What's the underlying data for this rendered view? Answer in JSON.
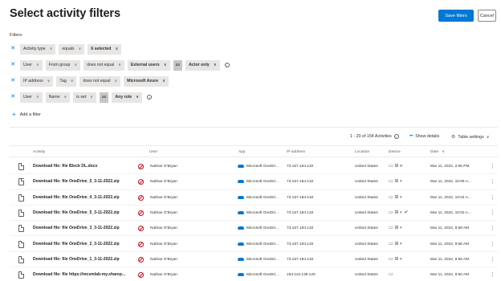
{
  "header": {
    "title": "Select activity filters",
    "save_label": "Save filters",
    "cancel_label": "Cancel"
  },
  "filters_label": "Filters:",
  "filters": [
    {
      "parts": [
        "Activity type",
        "equals",
        "6 selected"
      ],
      "bold": [
        false,
        false,
        true
      ],
      "info": false
    },
    {
      "parts": [
        "User",
        "From group",
        "does not equal",
        "External users",
        "as",
        "Actor only"
      ],
      "bold": [
        false,
        false,
        false,
        true,
        false,
        true
      ],
      "info": true
    },
    {
      "parts": [
        "IP address",
        "Tag",
        "does not equal",
        "Microsoft Azure"
      ],
      "bold": [
        false,
        false,
        false,
        true
      ],
      "info": false
    },
    {
      "parts": [
        "User",
        "Name",
        "is set",
        "as",
        "Any role"
      ],
      "bold": [
        false,
        false,
        false,
        false,
        true
      ],
      "info": true
    }
  ],
  "add_filter_label": "Add a filter",
  "summary": {
    "count_text": "1 - 20 of 154 Activities",
    "show_details": "Show details",
    "table_settings": "Table settings"
  },
  "table": {
    "headers": {
      "activity": "Activity",
      "user": "User",
      "app": "App",
      "ip": "IP address",
      "location": "Location",
      "device": "Device",
      "date": "Date"
    },
    "sort_indicator": "∨",
    "rows": [
      {
        "activity": "Download file: file Block DL.docx",
        "user": "Nathan O'Bryan",
        "app": "Microsoft OneDri...",
        "ip": "73.157.184.132",
        "location": "United States",
        "device": "▭ ⊞ ℯ",
        "date": "Mar 11, 2022, 2:55 PM"
      },
      {
        "activity": "Download file: file OneDrive_5_3-11-2022.zip",
        "user": "Nathan O'Bryan",
        "app": "Microsoft OneDri...",
        "ip": "73.157.184.132",
        "location": "United States",
        "device": "▭ ⊞ ◐",
        "date": "Mar 11, 2022, 10:05 A..."
      },
      {
        "activity": "Download file: file OneDrive_4_3-11-2022.zip",
        "user": "Nathan O'Bryan",
        "app": "Microsoft OneDri...",
        "ip": "73.157.184.132",
        "location": "United States",
        "device": "▭ ⊞ ◐",
        "date": "Mar 11, 2022, 10:04 A..."
      },
      {
        "activity": "Download file: file OneDrive_5_3-11-2022.zip",
        "user": "Nathan O'Bryan",
        "app": "Microsoft OneDri...",
        "ip": "73.157.184.132",
        "location": "United States",
        "device": "▭ ⊞ ◐ ✔",
        "date": "Mar 11, 2022, 10:02 A..."
      },
      {
        "activity": "Download file: file OneDrive_3_3-11-2022.zip",
        "user": "Nathan O'Bryan",
        "app": "Microsoft OneDri...",
        "ip": "73.157.184.132",
        "location": "United States",
        "device": "▭ ⊞ ◐",
        "date": "Mar 11, 2022, 9:58 AM"
      },
      {
        "activity": "Download file: file OneDrive_2_3-11-2022.zip",
        "user": "Nathan O'Bryan",
        "app": "Microsoft OneDri...",
        "ip": "73.157.184.132",
        "location": "United States",
        "device": "▭ ⊞ ◐",
        "date": "Mar 11, 2022, 9:56 AM"
      },
      {
        "activity": "Download file: file OneDrive_1_3-11-2022.zip",
        "user": "Nathan O'Bryan",
        "app": "Microsoft OneDri...",
        "ip": "73.157.184.132",
        "location": "United States",
        "device": "▭ ⊞ ◐",
        "date": "Mar 11, 2022, 9:56 AM"
      },
      {
        "activity": "Download file: file https://mcsmlab-my.sharep...",
        "user": "Nathan O'Bryan",
        "app": "Microsoft OneDri...",
        "ip": "163.116.138.120",
        "location": "United States",
        "device": "▭",
        "date": "Mar 11, 2022, 9:50 AM"
      }
    ]
  },
  "colors": {
    "accent": "#0078d4",
    "block": "#c50f1f",
    "chip": "#e7e6e5"
  },
  "icons": {
    "remove_filter": "close-icon",
    "add": "plus-icon",
    "doc": "document-icon",
    "user_status": "block-icon",
    "app": "onedrive-cloud-icon",
    "more": "more-vertical-icon"
  }
}
